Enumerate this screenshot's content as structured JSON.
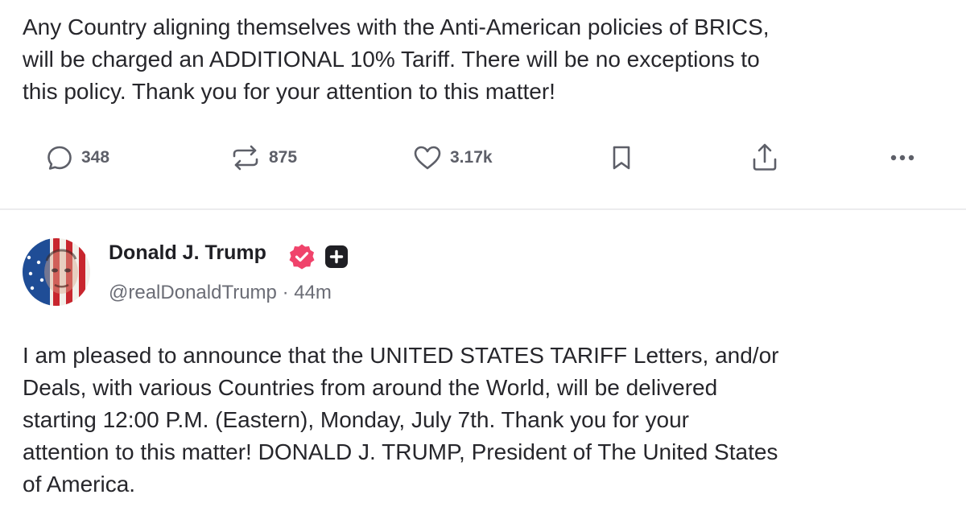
{
  "previous_post": {
    "text": "Any Country aligning themselves with the Anti-American policies of BRICS,\nwill be charged an ADDITIONAL 10% Tariff. There will be no exceptions to\nthis policy. Thank you for your attention to this matter!",
    "actions": {
      "replies": "348",
      "reposts": "875",
      "likes": "3.17k"
    }
  },
  "post": {
    "author_name": "Donald J. Trump",
    "handle": "@realDonaldTrump",
    "separator": "·",
    "time": "44m",
    "text": "I am pleased to announce that the UNITED STATES TARIFF Letters, and/or\nDeals, with various Countries from around the World, will be delivered\nstarting 12:00 P.M. (Eastern), Monday, July 7th. Thank you for your\nattention to this matter! DONALD J. TRUMP, President of The United States\nof America."
  },
  "icons": {
    "reply": "comment-bubble-icon",
    "repost": "repost-arrows-icon",
    "like": "heart-icon",
    "bookmark": "bookmark-icon",
    "share": "share-upload-icon",
    "more": "more-dots-icon",
    "verified": "verified-badge-icon",
    "plus": "plus-badge-icon"
  },
  "colors": {
    "verified_badge": "#f0436b",
    "action_icon": "#5d5f68",
    "divider": "#ececee"
  }
}
